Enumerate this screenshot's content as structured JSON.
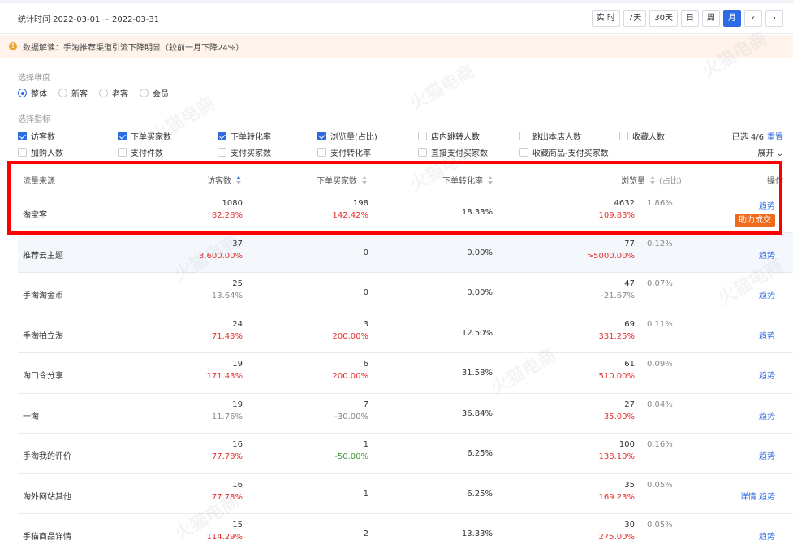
{
  "header": {
    "stat_time": "统计时间 2022-03-01 ~ 2022-03-31",
    "periods": [
      "实 时",
      "7天",
      "30天",
      "日",
      "周",
      "月"
    ],
    "active_period": "月",
    "prev_icon": "chevron-left-icon",
    "next_icon": "chevron-right-icon"
  },
  "notice": {
    "icon": "warning-icon",
    "text": "数据解读：手淘推荐渠道引流下降明显（较前一月下降24%）"
  },
  "dimension": {
    "label": "选择维度",
    "options": [
      "整体",
      "新客",
      "老客",
      "会员"
    ],
    "selected": "整体"
  },
  "metrics": {
    "label": "选择指标",
    "row1": [
      {
        "label": "访客数",
        "checked": true
      },
      {
        "label": "下单买家数",
        "checked": true
      },
      {
        "label": "下单转化率",
        "checked": true
      },
      {
        "label": "浏览量(占比)",
        "checked": true
      },
      {
        "label": "店内跳转人数",
        "checked": false
      },
      {
        "label": "跳出本店人数",
        "checked": false
      },
      {
        "label": "收藏人数",
        "checked": false
      }
    ],
    "row2": [
      {
        "label": "加购人数",
        "checked": false
      },
      {
        "label": "支付件数",
        "checked": false
      },
      {
        "label": "支付买家数",
        "checked": false
      },
      {
        "label": "支付转化率",
        "checked": false
      },
      {
        "label": "直接支付买家数",
        "checked": false
      },
      {
        "label": "收藏商品-支付买家数",
        "checked": false
      }
    ],
    "selected_count": "已选 4/6",
    "reset": "重置",
    "expand": "展开"
  },
  "table": {
    "columns": {
      "source": "流量来源",
      "visitors": "访客数",
      "buyers": "下单买家数",
      "rate": "下单转化率",
      "pv": "浏览量",
      "pv_share": "(占比)",
      "action": "操作"
    },
    "rows": [
      {
        "source": "淘宝客",
        "visitors": "1080",
        "visitors_chg": "82.28%",
        "visitors_dir": "up",
        "buyers": "198",
        "buyers_chg": "142.42%",
        "buyers_dir": "up",
        "rate": "18.33%",
        "pv": "4632",
        "pv_chg": "109.83%",
        "pv_dir": "up",
        "share": "1.86%",
        "actions": [
          "趋势"
        ],
        "badge": "助力成交"
      },
      {
        "source": "推荐云主题",
        "visitors": "37",
        "visitors_chg": "3,600.00%",
        "visitors_dir": "up",
        "buyers": "0",
        "buyers_chg": "",
        "buyers_dir": "neu",
        "rate": "0.00%",
        "pv": "77",
        "pv_chg": ">5000.00%",
        "pv_dir": "up",
        "share": "0.12%",
        "actions": [
          "趋势"
        ],
        "badge": ""
      },
      {
        "source": "手淘淘金币",
        "visitors": "25",
        "visitors_chg": "13.64%",
        "visitors_dir": "neu",
        "buyers": "0",
        "buyers_chg": "",
        "buyers_dir": "neu",
        "rate": "0.00%",
        "pv": "47",
        "pv_chg": "-21.67%",
        "pv_dir": "neu",
        "share": "0.07%",
        "actions": [
          "趋势"
        ],
        "badge": ""
      },
      {
        "source": "手淘拍立淘",
        "visitors": "24",
        "visitors_chg": "71.43%",
        "visitors_dir": "up",
        "buyers": "3",
        "buyers_chg": "200.00%",
        "buyers_dir": "up",
        "rate": "12.50%",
        "pv": "69",
        "pv_chg": "331.25%",
        "pv_dir": "up",
        "share": "0.11%",
        "actions": [
          "趋势"
        ],
        "badge": ""
      },
      {
        "source": "淘口令分享",
        "visitors": "19",
        "visitors_chg": "171.43%",
        "visitors_dir": "up",
        "buyers": "6",
        "buyers_chg": "200.00%",
        "buyers_dir": "up",
        "rate": "31.58%",
        "pv": "61",
        "pv_chg": "510.00%",
        "pv_dir": "up",
        "share": "0.09%",
        "actions": [
          "趋势"
        ],
        "badge": ""
      },
      {
        "source": "一淘",
        "visitors": "19",
        "visitors_chg": "11.76%",
        "visitors_dir": "neu",
        "buyers": "7",
        "buyers_chg": "-30.00%",
        "buyers_dir": "neu",
        "rate": "36.84%",
        "pv": "27",
        "pv_chg": "35.00%",
        "pv_dir": "up",
        "share": "0.04%",
        "actions": [
          "趋势"
        ],
        "badge": ""
      },
      {
        "source": "手淘我的评价",
        "visitors": "16",
        "visitors_chg": "77.78%",
        "visitors_dir": "up",
        "buyers": "1",
        "buyers_chg": "-50.00%",
        "buyers_dir": "down",
        "rate": "6.25%",
        "pv": "100",
        "pv_chg": "138.10%",
        "pv_dir": "up",
        "share": "0.16%",
        "actions": [
          "趋势"
        ],
        "badge": ""
      },
      {
        "source": "淘外网站其他",
        "visitors": "16",
        "visitors_chg": "77.78%",
        "visitors_dir": "up",
        "buyers": "1",
        "buyers_chg": "",
        "buyers_dir": "neu",
        "rate": "6.25%",
        "pv": "35",
        "pv_chg": "169.23%",
        "pv_dir": "up",
        "share": "0.05%",
        "actions": [
          "详情",
          "趋势"
        ],
        "badge": ""
      },
      {
        "source": "手猫商品详情",
        "visitors": "15",
        "visitors_chg": "114.29%",
        "visitors_dir": "up",
        "buyers": "2",
        "buyers_chg": "",
        "buyers_dir": "neu",
        "rate": "13.33%",
        "pv": "30",
        "pv_chg": "275.00%",
        "pv_dir": "up",
        "share": "0.05%",
        "actions": [
          "趋势"
        ],
        "badge": ""
      }
    ]
  },
  "watermark": "火猫电商",
  "colors": {
    "accent": "#2d6be4",
    "up": "#e5302e",
    "down": "#3d9a3d",
    "badge": "#ee6a1c",
    "highlight_box": "#ff0000"
  }
}
